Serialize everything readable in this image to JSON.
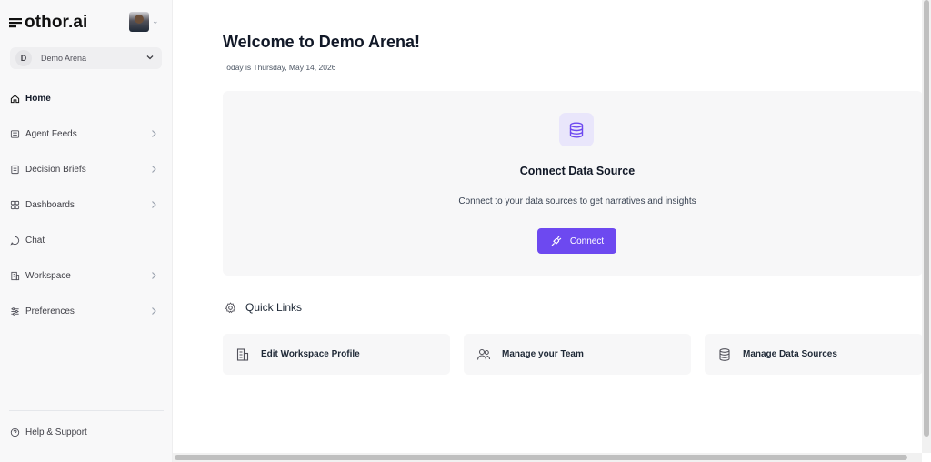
{
  "brand": {
    "name": "othor.ai"
  },
  "workspace_selector": {
    "initial": "D",
    "name": "Demo Arena"
  },
  "sidebar": {
    "items": [
      {
        "label": "Home",
        "icon": "home-icon",
        "active": true,
        "has_chevron": false
      },
      {
        "label": "Agent Feeds",
        "icon": "feed-icon",
        "active": false,
        "has_chevron": true
      },
      {
        "label": "Decision Briefs",
        "icon": "document-icon",
        "active": false,
        "has_chevron": true
      },
      {
        "label": "Dashboards",
        "icon": "grid-icon",
        "active": false,
        "has_chevron": true
      },
      {
        "label": "Chat",
        "icon": "chat-icon",
        "active": false,
        "has_chevron": false
      },
      {
        "label": "Workspace",
        "icon": "building-icon",
        "active": false,
        "has_chevron": true
      },
      {
        "label": "Preferences",
        "icon": "sliders-icon",
        "active": false,
        "has_chevron": true
      }
    ],
    "help": {
      "label": "Help & Support",
      "icon": "help-icon"
    }
  },
  "main": {
    "title": "Welcome to Demo Arena!",
    "date_text": "Today is Thursday, May 14, 2026",
    "connect_card": {
      "icon": "database-icon",
      "title": "Connect Data Source",
      "subtitle": "Connect to your data sources to get narratives and insights",
      "button_label": "Connect",
      "button_icon": "plug-icon"
    },
    "quick_links": {
      "title": "Quick Links",
      "icon": "gear-icon",
      "items": [
        {
          "label": "Edit Workspace Profile",
          "icon": "building-icon"
        },
        {
          "label": "Manage your Team",
          "icon": "users-icon"
        },
        {
          "label": "Manage Data Sources",
          "icon": "database-icon"
        }
      ]
    }
  },
  "colors": {
    "accent": "#6d49f0",
    "accent_soft": "#e9e6fb",
    "sidebar_bg": "#f8f8f9",
    "card_bg": "#f7f7f8"
  }
}
